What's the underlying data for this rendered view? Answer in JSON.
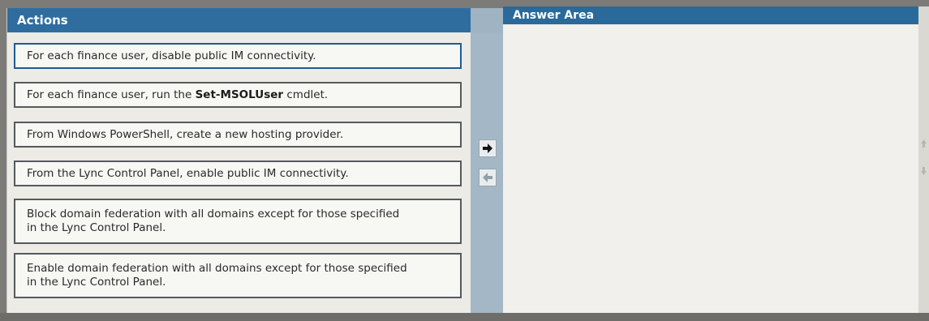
{
  "actions_panel": {
    "title": "Actions",
    "items": [
      {
        "prefix": "For each finance user, disable public IM connectivity.",
        "bold": "",
        "suffix": ""
      },
      {
        "prefix": "For each finance user, run the ",
        "bold": "Set-MSOLUser",
        "suffix": " cmdlet."
      },
      {
        "prefix": "From Windows PowerShell, create a new hosting provider.",
        "bold": "",
        "suffix": ""
      },
      {
        "prefix": "From the Lync Control Panel, enable public IM connectivity.",
        "bold": "",
        "suffix": ""
      },
      {
        "prefix": "Block domain federation with all domains except for those specified in the Lync Control Panel.",
        "bold": "",
        "suffix": ""
      },
      {
        "prefix": "Enable domain federation with all domains except for those specified in the Lync Control Panel.",
        "bold": "",
        "suffix": ""
      }
    ]
  },
  "answer_area": {
    "title": "Answer Area"
  },
  "controls": {
    "move_right_icon": "arrow-right-icon",
    "move_left_icon": "arrow-left-icon",
    "move_up_icon": "arrow-up-icon",
    "move_down_icon": "arrow-down-icon"
  },
  "colors": {
    "header_blue": "#2f6d9e",
    "item_border": "#555a5e",
    "selected_border": "#1d5d96",
    "divider": "#a4b7c6"
  }
}
